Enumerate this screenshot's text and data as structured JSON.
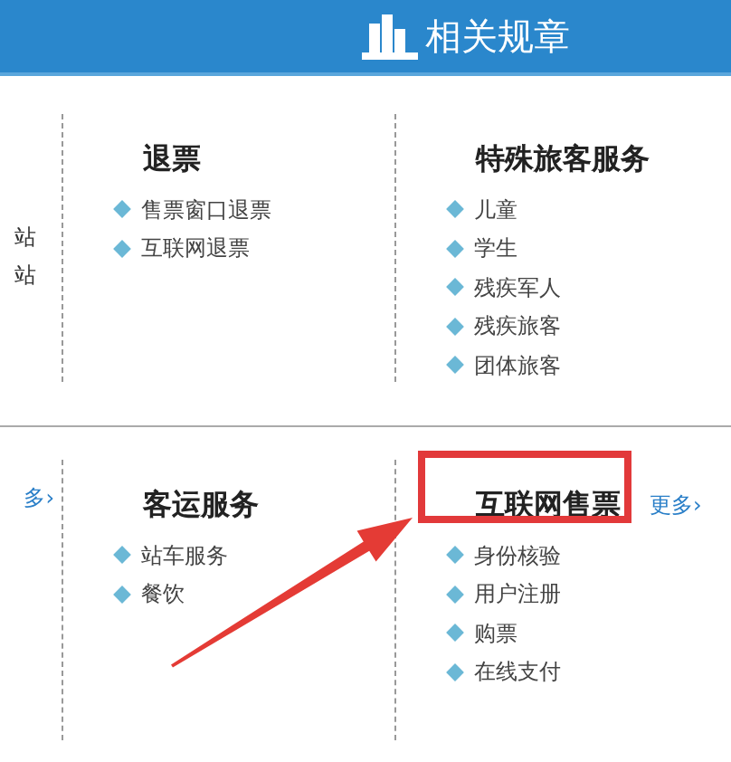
{
  "header": {
    "title": "相关规章"
  },
  "sections": [
    {
      "cut_items": [
        "站",
        "站"
      ],
      "columns": [
        {
          "title": "退票",
          "highlighted": false,
          "items": [
            "售票窗口退票",
            "互联网退票"
          ]
        },
        {
          "title": "特殊旅客服务",
          "highlighted": false,
          "items": [
            "儿童",
            "学生",
            "残疾军人",
            "残疾旅客",
            "团体旅客"
          ]
        }
      ]
    },
    {
      "cut_more": "多›",
      "columns": [
        {
          "title": "客运服务",
          "highlighted": false,
          "items": [
            "站车服务",
            "餐饮"
          ]
        },
        {
          "title": "互联网售票",
          "highlighted": true,
          "more": "更多›",
          "items": [
            "身份核验",
            "用户注册",
            "购票",
            "在线支付"
          ]
        }
      ]
    }
  ]
}
